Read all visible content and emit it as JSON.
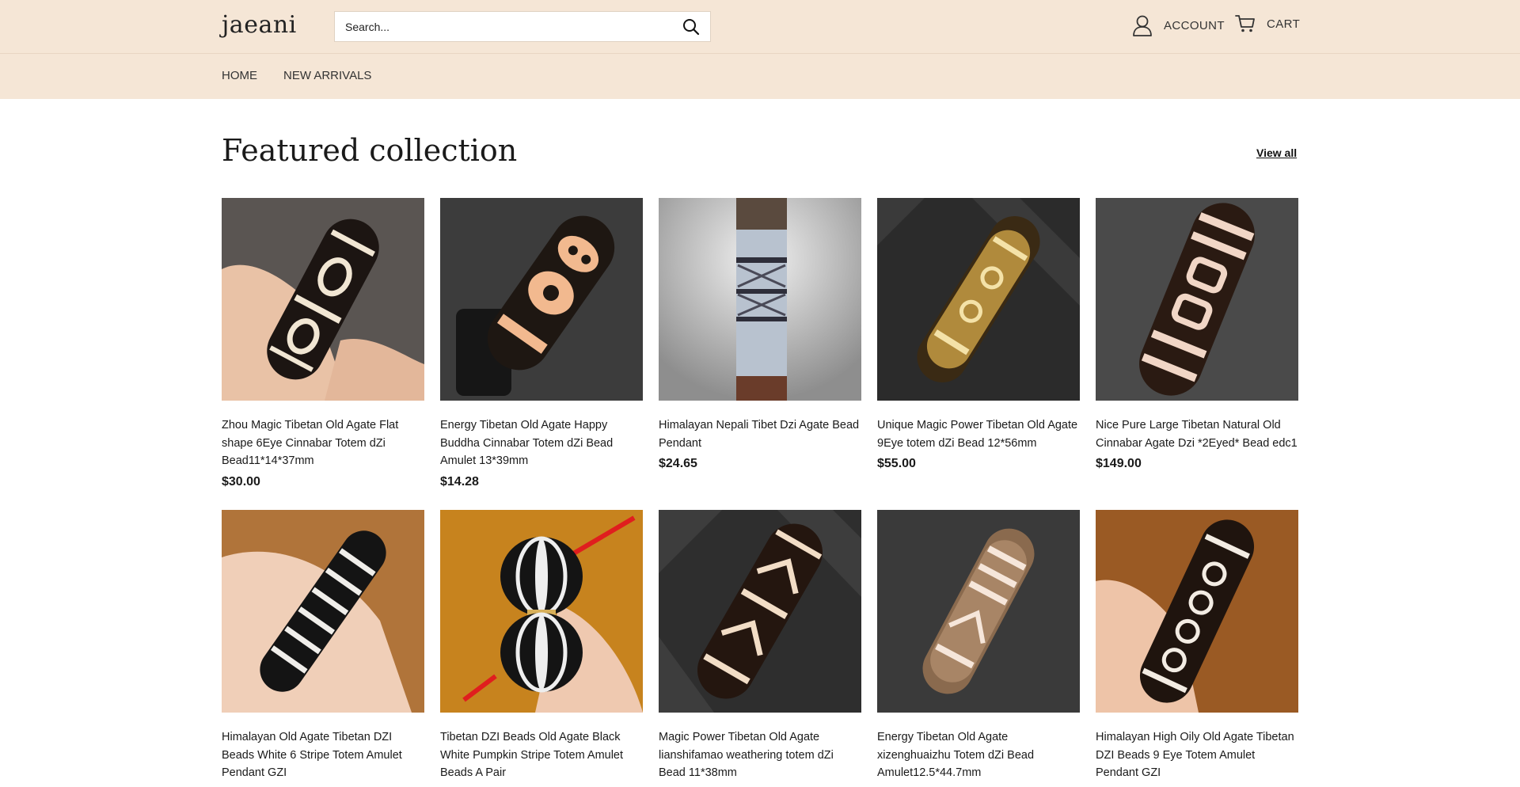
{
  "header": {
    "logo": "jaeani",
    "search_placeholder": "Search...",
    "account_label": "ACCOUNT",
    "cart_label": "CART"
  },
  "nav": {
    "items": [
      {
        "label": "HOME"
      },
      {
        "label": "NEW ARRIVALS"
      }
    ]
  },
  "collection": {
    "title": "Featured collection",
    "view_all": "View all",
    "products": [
      {
        "title": "Zhou Magic Tibetan Old Agate Flat shape 6Eye Cinnabar Totem dZi Bead11*14*37mm",
        "price": "$30.00"
      },
      {
        "title": "Energy Tibetan Old Agate Happy Buddha Cinnabar Totem dZi Bead Amulet 13*39mm",
        "price": "$14.28"
      },
      {
        "title": "Himalayan Nepali Tibet Dzi Agate Bead Pendant",
        "price": "$24.65"
      },
      {
        "title": "Unique Magic Power Tibetan Old Agate 9Eye totem dZi Bead 12*56mm",
        "price": "$55.00"
      },
      {
        "title": "Nice Pure Large Tibetan Natural Old Cinnabar Agate Dzi *2Eyed* Bead edc1",
        "price": "$149.00"
      },
      {
        "title": "Himalayan Old Agate Tibetan DZI Beads White 6 Stripe Totem Amulet Pendant GZI",
        "price": ""
      },
      {
        "title": "Tibetan DZI Beads Old Agate Black White Pumpkin Stripe Totem Amulet Beads A Pair",
        "price": ""
      },
      {
        "title": "Magic Power Tibetan Old Agate lianshifamao weathering totem dZi Bead 11*38mm",
        "price": ""
      },
      {
        "title": "Energy Tibetan Old Agate xizenghuaizhu Totem dZi Bead Amulet12.5*44.7mm",
        "price": ""
      },
      {
        "title": "Himalayan High Oily Old Agate Tibetan DZI Beads 9 Eye Totem Amulet Pendant GZI",
        "price": ""
      }
    ]
  }
}
